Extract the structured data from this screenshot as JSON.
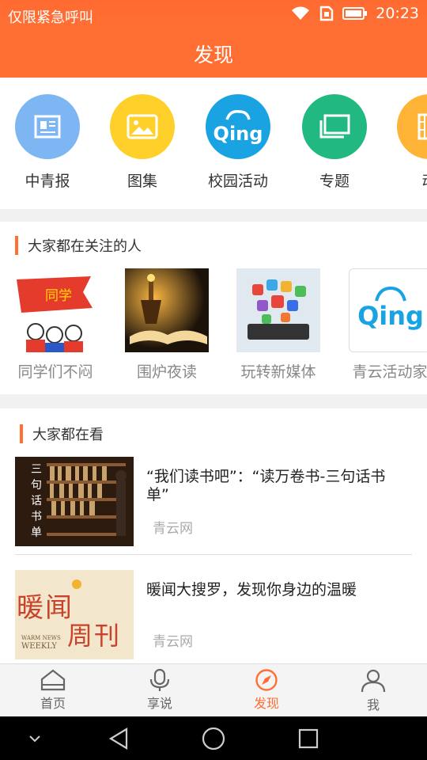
{
  "status_bar": {
    "carrier": "仅限紧急呼叫",
    "time": "20:23",
    "icons": [
      "wifi-icon",
      "sim-icon",
      "battery-icon"
    ]
  },
  "header": {
    "title": "发现"
  },
  "categories": [
    {
      "label": "中青报",
      "icon": "newspaper-icon",
      "color": "#7eb6f3"
    },
    {
      "label": "图集",
      "icon": "picture-icon",
      "color": "#ffd02a"
    },
    {
      "label": "校园活动",
      "icon": "qing-logo-icon",
      "color": "#1aa3e3"
    },
    {
      "label": "专题",
      "icon": "stack-icon",
      "color": "#22b882"
    },
    {
      "label": "动",
      "icon": "film-icon",
      "color": "#ffb437"
    }
  ],
  "follow_section": {
    "title": "大家都在关注的人",
    "people": [
      {
        "label": "同学们不闷",
        "flag_text": "同学"
      },
      {
        "label": "围炉夜读"
      },
      {
        "label": "玩转新媒体"
      },
      {
        "label": "青云活动家",
        "logo_text": "Qing"
      }
    ]
  },
  "watch_section": {
    "title": "大家都在看",
    "articles": [
      {
        "title": "“我们读书吧”：“读万卷书-三句话书单”",
        "source": "青云网",
        "thumb_text": [
          "三",
          "句",
          "话",
          "书",
          "单"
        ]
      },
      {
        "title": "暖闻大搜罗，发现你身边的温暖",
        "source": "青云网",
        "thumb_text": [
          "暖闻",
          "周刊",
          "WARM NEWS",
          "WEEKLY"
        ]
      }
    ]
  },
  "tab_bar": {
    "tabs": [
      {
        "label": "首页",
        "icon": "home-icon"
      },
      {
        "label": "享说",
        "icon": "microphone-icon"
      },
      {
        "label": "发现",
        "icon": "compass-icon",
        "active": true
      },
      {
        "label": "我",
        "icon": "person-icon"
      }
    ],
    "active_color": "#ff6f34"
  },
  "colors": {
    "brand": "#ff6f34"
  }
}
